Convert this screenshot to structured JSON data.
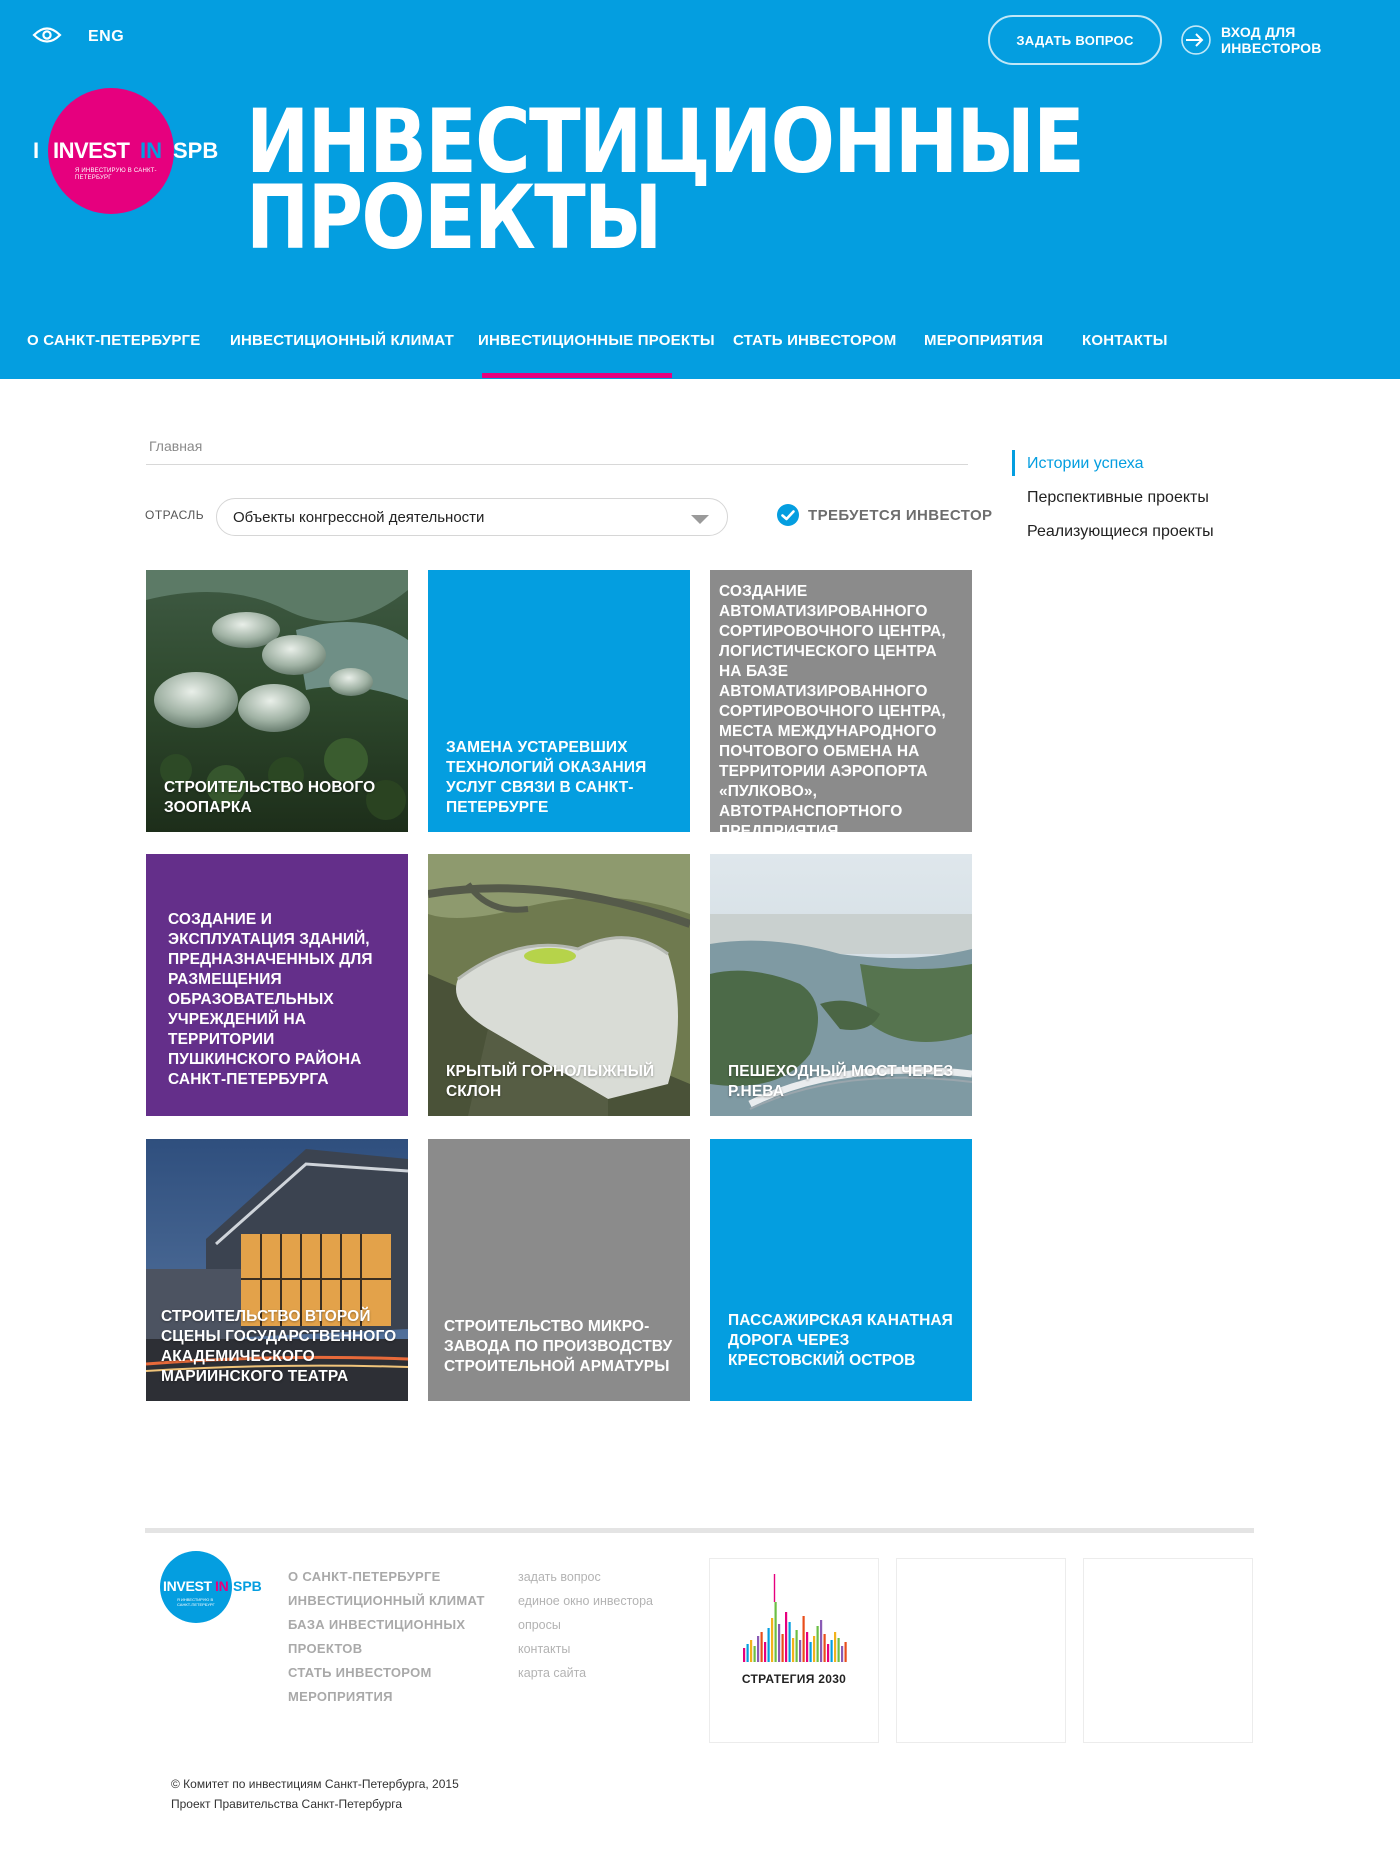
{
  "header": {
    "lang": "ENG",
    "ask_button": "ЗАДАТЬ ВОПРОС",
    "login_label": "ВХОД ДЛЯ ИНВЕСТОРОВ",
    "logo": {
      "i": "I",
      "invest": "INVEST",
      "in": "IN",
      "spb": "SPB",
      "sub": "Я ИНВЕСТИРУЮ В САНКТ-ПЕТЕРБУРГ"
    },
    "title_line1": "ИНВЕСТИЦИОННЫЕ",
    "title_line2": "ПРОЕКТЫ",
    "accent_color": "#e6007e",
    "brand_color": "#049ee0"
  },
  "nav": {
    "items": [
      {
        "label": "О САНКТ-ПЕТЕРБУРГЕ"
      },
      {
        "label": "ИНВЕСТИЦИОННЫЙ КЛИМАТ"
      },
      {
        "label": "ИНВЕСТИЦИОННЫЕ ПРОЕКТЫ",
        "active": true
      },
      {
        "label": "СТАТЬ ИНВЕСТОРОМ"
      },
      {
        "label": "МЕРОПРИЯТИЯ"
      },
      {
        "label": "КОНТАКТЫ"
      }
    ]
  },
  "breadcrumb": "Главная",
  "filter": {
    "label": "ОТРАСЛЬ",
    "selected": "Объекты конгрессной деятельности",
    "investor_required": "ТРЕБУЕТСЯ ИНВЕСТОР",
    "investor_checked": true
  },
  "projects": [
    {
      "title": "Строительство нового зоопарка",
      "kind": "image",
      "icon": "zoo-domes-image"
    },
    {
      "title": "Замена устаревших технологий оказания услуг связи в Санкт-Петербурге",
      "kind": "solid",
      "color": "#049ee0"
    },
    {
      "title": "Создание автоматизированного сортировочного центра, логистического центра на базе автоматизированного сортировочного центра, места международного почтового обмена на территории аэропорта «Пулково», автотранспортного предприятия",
      "kind": "solid",
      "color": "#8b8b8b"
    },
    {
      "title": "Создание и эксплуатация зданий, предназначенных для размещения образовательных учреждений на территории Пушкинского района Санкт-Петербурга",
      "kind": "solid",
      "color": "#642f8a"
    },
    {
      "title": "Крытый горнолыжный склон",
      "kind": "image",
      "icon": "ski-slope-image"
    },
    {
      "title": "Пешеходный мост через р.Нева",
      "kind": "image",
      "icon": "river-bridge-image"
    },
    {
      "title": "Строительство второй сцены Государственного академического Мариинского театра",
      "kind": "image",
      "icon": "theatre-image"
    },
    {
      "title": "Строительство микро-завода по производству строительной арматуры",
      "kind": "solid",
      "color": "#8b8b8b"
    },
    {
      "title": "Пассажирская канатная дорога через Крестовский остров",
      "kind": "solid",
      "color": "#049ee0"
    }
  ],
  "sidebar": {
    "items": [
      {
        "label": "Истории успеха",
        "active": true
      },
      {
        "label": "Перспективные проекты"
      },
      {
        "label": "Реализующиеся проекты"
      }
    ]
  },
  "footer": {
    "logo": {
      "i": "I",
      "invest": "INVEST",
      "in": "IN",
      "spb": "SPB",
      "sub": "Я ИНВЕСТИРУЮ В САНКТ-ПЕТЕРБУРГ"
    },
    "nav": [
      "О САНКТ-ПЕТЕРБУРГЕ",
      "ИНВЕСТИЦИОННЫЙ КЛИМАТ",
      "БАЗА ИНВЕСТИЦИОННЫХ",
      "ПРОЕКТОВ",
      "СТАТЬ ИНВЕСТОРОМ",
      "МЕРОПРИЯТИЯ"
    ],
    "links": [
      "задать вопрос",
      "единое окно инвестора",
      "опросы",
      "контакты",
      "карта сайта"
    ],
    "strategy_label": "СТРАТЕГИЯ 2030",
    "copyright_line1": "© Комитет по инвестициям Санкт-Петербурга, 2015",
    "copyright_line2": "Проект Правительства Санкт-Петербурга"
  }
}
